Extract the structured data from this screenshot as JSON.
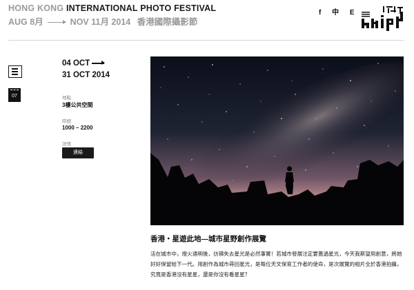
{
  "header": {
    "title_part1": "HONG KONG",
    "title_part2": "INTERNATIONAL",
    "title_part3": "PHOTO FESTIVAL",
    "date_start": "AUG 8月",
    "date_end": "NOV 11月 2014",
    "title_cn": "香港國際攝影節",
    "languages": [
      "f",
      "中",
      "E"
    ],
    "logo_text": "hkipf"
  },
  "sidebar": {
    "badge_label": "07"
  },
  "event": {
    "date_from": "04 OCT",
    "date_to": "31 OCT 2014",
    "venue_label": "地點",
    "venue_value": "3樓公共空間",
    "time_label": "時間",
    "time_value": "1000 – 2200",
    "details_label": "詳情",
    "details_button": "連結"
  },
  "article": {
    "title": "香港・星遊此地—城市星野創作展覽",
    "body": "活在城市中，燈火通明後，彷彿失去星光是必然事實！若城市發展注定要蓋過星光，今天我斯望用創意，將她好好保留給下一代。用創作為城市尋回星光，是每位天文保育工作者的使命，是次展覽的相片全於香港拍攝，究竟是香港沒有星星，還是你沒有看星星？"
  },
  "colors": {
    "accent": "#111111",
    "muted": "#9a9a9a",
    "sky_top": "#0d1020",
    "horizon_glow": "#b07b7e"
  }
}
